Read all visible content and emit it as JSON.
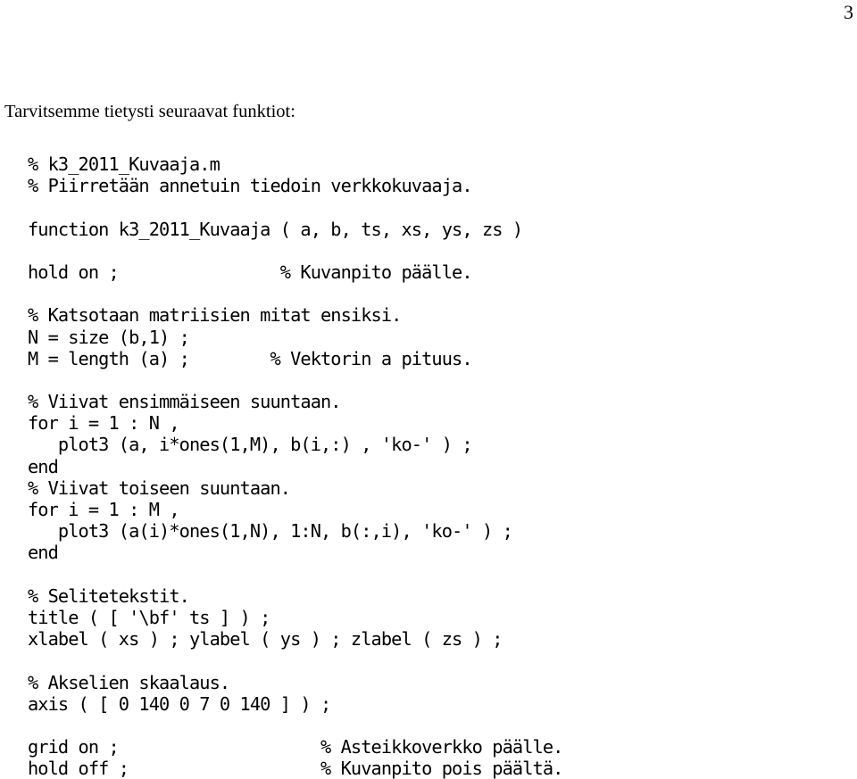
{
  "page_number": "3",
  "intro_text": "Tarvitsemme tietysti seuraavat funktiot:",
  "code": {
    "language": "MATLAB",
    "filename": "k3_2011_Kuvaaja.m",
    "lines": [
      "% k3_2011_Kuvaaja.m",
      "% Piirretään annetuin tiedoin verkkokuvaaja.",
      "",
      "function k3_2011_Kuvaaja ( a, b, ts, xs, ys, zs )",
      "",
      "hold on ;                % Kuvanpito päälle.",
      "",
      "% Katsotaan matriisien mitat ensiksi.",
      "N = size (b,1) ;",
      "M = length (a) ;        % Vektorin a pituus.",
      "",
      "% Viivat ensimmäiseen suuntaan.",
      "for i = 1 : N ,",
      "   plot3 (a, i*ones(1,M), b(i,:) , 'ko-' ) ;",
      "end",
      "% Viivat toiseen suuntaan.",
      "for i = 1 : M ,",
      "   plot3 (a(i)*ones(1,N), 1:N, b(:,i), 'ko-' ) ;",
      "end",
      "",
      "% Selitetekstit.",
      "title ( [ '\\bf' ts ] ) ;",
      "xlabel ( xs ) ; ylabel ( ys ) ; zlabel ( zs ) ;",
      "",
      "% Akselien skaalaus.",
      "axis ( [ 0 140 0 7 0 140 ] ) ;",
      "",
      "grid on ;                    % Asteikkoverkko päälle.",
      "hold off ;                   % Kuvanpito pois päältä."
    ]
  }
}
